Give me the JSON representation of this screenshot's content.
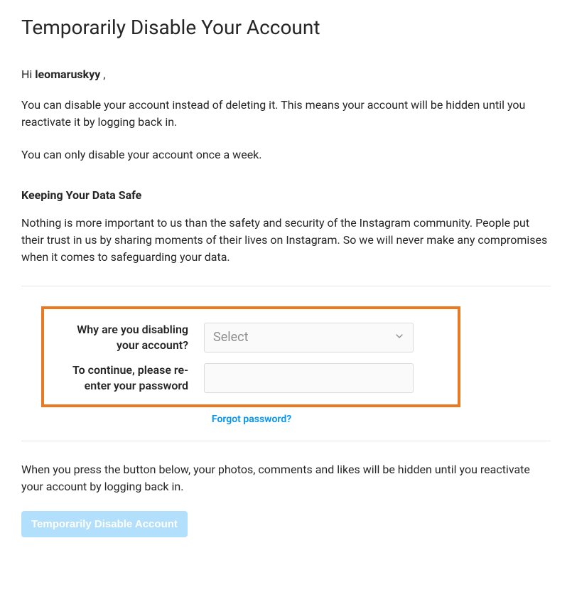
{
  "title": "Temporarily Disable Your Account",
  "greeting": {
    "hi": "Hi ",
    "username": "leomaruskyy",
    "tail": " ,"
  },
  "para_disable": "You can disable your account instead of deleting it. This means your account will be hidden until you reactivate it by logging back in.",
  "para_once": "You can only disable your account once a week.",
  "subhead_safe": "Keeping Your Data Safe",
  "para_safe": "Nothing is more important to us than the safety and security of the Instagram community. People put their trust in us by sharing moments of their lives on Instagram. So we will never make any compromises when it comes to safeguarding your data.",
  "form": {
    "reason_label": "Why are you disabling your account?",
    "reason_placeholder": "Select",
    "password_label": "To continue, please re-enter your password",
    "forgot": "Forgot password?"
  },
  "para_hidden": "When you press the button below, your photos, comments and likes will be hidden until you reactivate your account by logging back in.",
  "submit_label": "Temporarily Disable Account"
}
